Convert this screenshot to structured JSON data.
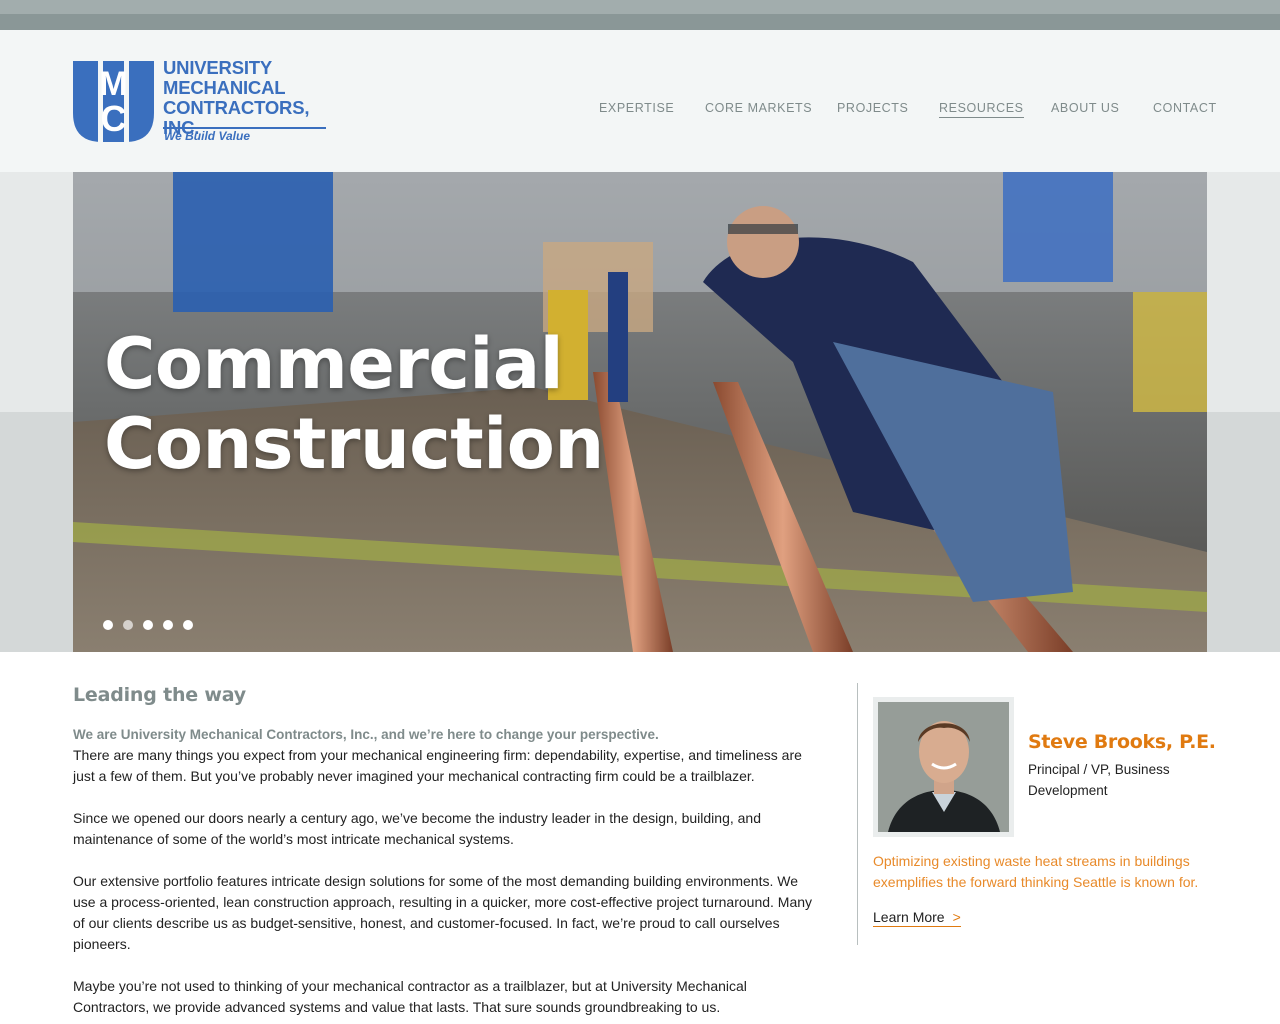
{
  "brand": {
    "name_lines": [
      "UNIVERSITY",
      "MECHANICAL",
      "CONTRACTORS, INC."
    ],
    "tagline": "We Build Value",
    "monogram_top": "M",
    "monogram_bottom": "C",
    "color": "#3a6fbe"
  },
  "nav": {
    "items": [
      {
        "label": "EXPERTISE"
      },
      {
        "label": "CORE MARKETS"
      },
      {
        "label": "PROJECTS"
      },
      {
        "label": "RESOURCES",
        "active": true
      },
      {
        "label": "ABOUT US"
      },
      {
        "label": "CONTACT"
      }
    ]
  },
  "hero": {
    "headline_line1": "Commercial",
    "headline_line2": "Construction",
    "slide_count": 5,
    "active_slide": 1
  },
  "intro": {
    "heading": "Leading the way",
    "lead": "We are University Mechanical Contractors, Inc., and we’re here to change your perspective.",
    "paragraphs": [
      "There are many things you expect from your mechanical engineering firm: dependability, expertise, and timeliness are just a few of them. But you’ve probably never imagined your mechanical contracting firm could be a trailblazer.",
      "Since we opened our doors nearly a century ago, we’ve become the industry leader in the design, building, and maintenance of some of the world’s most intricate mechanical systems.",
      "Our extensive portfolio features intricate design solutions for some of the most demanding building environments. We use a process-oriented, lean construction approach, resulting in a quicker, more cost-effective project turnaround. Many of our clients describe us as budget-sensitive, honest, and customer-focused. In fact, we’re proud to call ourselves pioneers.",
      "Maybe you’re not used to thinking of your mechanical contractor as a trailblazer, but at University Mechanical Contractors, we provide advanced systems and value that lasts. That sure sounds groundbreaking to us."
    ]
  },
  "profile": {
    "name": "Steve Brooks, P.E.",
    "title": "Principal / VP, Business Development",
    "quote": "Optimizing existing waste heat streams in buildings exemplifies the forward thinking Seattle is known for.",
    "link_label": "Learn More",
    "link_chevron": ">"
  },
  "colors": {
    "accent": "#e07a10",
    "nav_text": "#7f8b8b",
    "brand_blue": "#3a6fbe"
  }
}
